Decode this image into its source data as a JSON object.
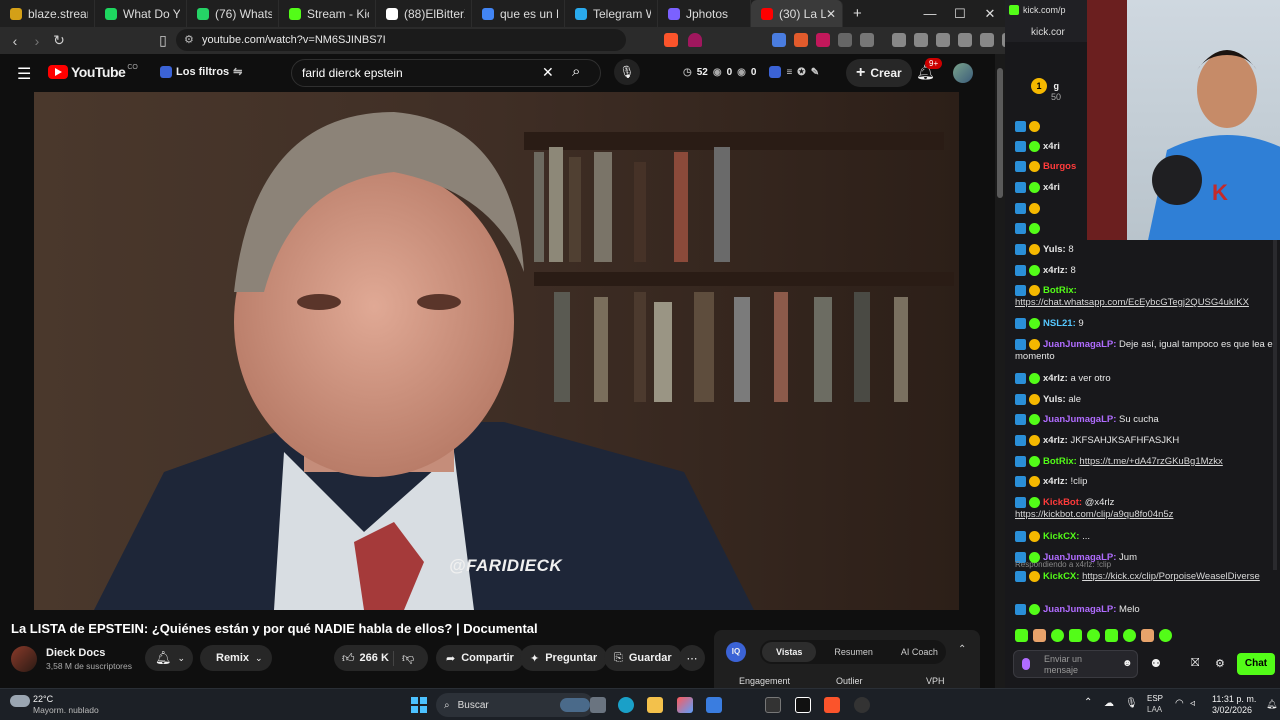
{
  "tabs": [
    {
      "label": "blaze.stream/stre",
      "color": "#d4a017",
      "active": false
    },
    {
      "label": "What Do You",
      "color": "#1ed760",
      "active": false
    },
    {
      "label": "(76) WhatsApp",
      "color": "#25d366",
      "active": false
    },
    {
      "label": "Stream - Kick Da",
      "color": "#53fc18",
      "active": false
    },
    {
      "label": "(88)ElBitterX (@el",
      "color": "#ffffff",
      "active": false
    },
    {
      "label": "que es un LUSH",
      "color": "#4285f4",
      "active": false
    },
    {
      "label": "Telegram Web",
      "color": "#2aabee",
      "active": false
    },
    {
      "label": "Jphotos",
      "color": "#7b61ff",
      "active": false
    },
    {
      "label": "(30) La LI",
      "color": "#ff0000",
      "active": true
    }
  ],
  "new_tab": "+",
  "window": {
    "minimize": "—",
    "maximize": "☐",
    "close": "✕"
  },
  "address": {
    "url": "youtube.com/watch?v=NM6SJINBS7I"
  },
  "youtube": {
    "logo": "YouTube",
    "country": "CO",
    "filters_label": "Los filtros",
    "search_value": "farid dierck epstein",
    "stat_52": "52",
    "stat_0a": "0",
    "stat_0b": "0",
    "create_label": "Crear",
    "notif_badge": "9+"
  },
  "video": {
    "watermark": "@FARIDIECK"
  },
  "info": {
    "title": "La LISTA de EPSTEIN: ¿Quiénes están y por qué NADIE habla de ellos? | Documental",
    "channel": "Dieck Docs",
    "subscribers": "3,58 M de suscriptores",
    "remix": "Remix",
    "likes": "266 K",
    "share": "Compartir",
    "ask": "Preguntar",
    "save": "Guardar"
  },
  "analytics": {
    "tabs": [
      "Vistas",
      "Resumen",
      "AI Coach"
    ],
    "cols": [
      "Engagement",
      "Outlier",
      "VPH"
    ],
    "logo": "IQ"
  },
  "kick": {
    "url": "kick.com/p",
    "url2": "kick.cor",
    "top_user": "g",
    "top_num": "50",
    "chat": [
      {
        "user": "",
        "color": "#53fc18",
        "msg": ""
      },
      {
        "user": "x4ri",
        "color": "#e6e6e6",
        "msg": ""
      },
      {
        "user": "Burgos",
        "color": "#ff3b3b",
        "msg": ""
      },
      {
        "user": "x4ri",
        "color": "#e6e6e6",
        "msg": ""
      },
      {
        "user": "",
        "color": "#e6e6e6",
        "msg": ""
      },
      {
        "user": "",
        "color": "#e6e6e6",
        "msg": ""
      },
      {
        "user": "Yuls:",
        "color": "#e6e6e6",
        "msg": " 8"
      },
      {
        "user": "x4rlz:",
        "color": "#e6e6e6",
        "msg": " 8"
      },
      {
        "user": "BotRix:",
        "color": "#53fc18",
        "msg": "",
        "link": "https://chat.whatsapp.com/EcEybcGTegj2QUSG4ukIKX"
      },
      {
        "user": "NSL21:",
        "color": "#56c8ff",
        "msg": " 9"
      },
      {
        "user": "JuanJumagaLP:",
        "color": "#b06cff",
        "msg": " Deje así, igual tampoco es que lea el momento"
      },
      {
        "user": "x4rlz:",
        "color": "#e6e6e6",
        "msg": " a ver otro"
      },
      {
        "user": "Yuls:",
        "color": "#e6e6e6",
        "msg": " ale"
      },
      {
        "user": "JuanJumagaLP:",
        "color": "#b06cff",
        "msg": " Su cucha"
      },
      {
        "user": "x4rlz:",
        "color": "#e6e6e6",
        "msg": " JKFSAHJKSAFHFASJKH"
      },
      {
        "user": "BotRix:",
        "color": "#53fc18",
        "msg": " ",
        "link": "https://t.me/+dA47rzGKuBg1Mzkx"
      },
      {
        "user": "x4rlz:",
        "color": "#e6e6e6",
        "msg": " !clip"
      },
      {
        "user": "KickBot:",
        "color": "#ff3b3b",
        "msg": " @x4rlz",
        "link": "https://kickbot.com/clip/a9qu8fo04n5z"
      },
      {
        "user": "KickCX:",
        "color": "#53fc18",
        "msg": " ..."
      },
      {
        "user": "JuanJumagaLP:",
        "color": "#b06cff",
        "msg": " Jum"
      },
      {
        "user": "KickCX:",
        "color": "#53fc18",
        "msg": " ",
        "link": "https://kick.cx/clip/PorpoiseWeaselDiverse",
        "reply": "Respondiendo a x4rlz: !clip"
      },
      {
        "user": "JuanJumagaLP:",
        "color": "#b06cff",
        "msg": " Melo"
      }
    ],
    "input_placeholder": "Enviar un mensaje",
    "chat_button": "Chat"
  },
  "taskbar": {
    "weather_temp": "22°C",
    "weather_desc": "Mayorm. nublado",
    "search": "Buscar",
    "lang": "ESP",
    "lang2": "LAA",
    "time": "11:31 p. m.",
    "date": "3/02/2026"
  }
}
